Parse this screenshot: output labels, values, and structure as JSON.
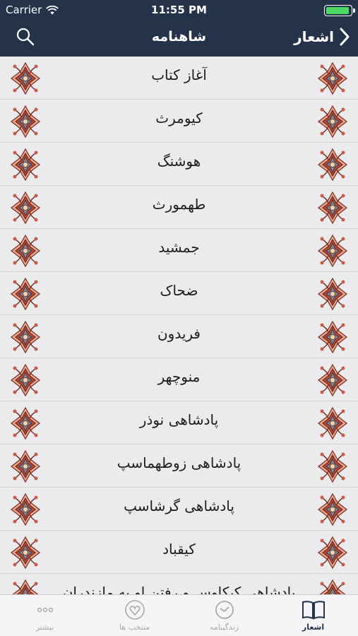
{
  "status_bar": {
    "carrier": "Carrier",
    "time": "11:55 PM",
    "battery_level": 0.95,
    "battery_color": "#4cd964"
  },
  "nav_bar": {
    "title": "شاهنامه",
    "back_label": "اشعار",
    "back_icon": "chevron-left-icon",
    "search_icon": "search-icon",
    "background": "#24334a"
  },
  "list": {
    "ornament_icon": "floral-ornament-icon",
    "items": [
      {
        "label": "آغاز کتاب"
      },
      {
        "label": "کیومرث"
      },
      {
        "label": "هوشنگ"
      },
      {
        "label": "طهمورث"
      },
      {
        "label": "جمشید"
      },
      {
        "label": "ضحاک"
      },
      {
        "label": "فریدون"
      },
      {
        "label": "منوچهر"
      },
      {
        "label": "پادشاهی نوذر"
      },
      {
        "label": "پادشاهی زوطهماسپ"
      },
      {
        "label": "پادشاهی گرشاسپ"
      },
      {
        "label": "کیقباد"
      },
      {
        "label": "پادشاهی کیکاوس و رفتن او به مازندران"
      }
    ]
  },
  "tab_bar": {
    "tabs": [
      {
        "label": "اشعار",
        "icon": "open-book-icon",
        "active": true
      },
      {
        "label": "زندگینامه",
        "icon": "clock-history-icon",
        "active": false
      },
      {
        "label": "منتخب ها",
        "icon": "heart-icon",
        "active": false
      },
      {
        "label": "بیشتر",
        "icon": "more-dots-icon",
        "active": false
      }
    ],
    "active_color": "#24334a",
    "inactive_color": "#a9a9ad"
  }
}
